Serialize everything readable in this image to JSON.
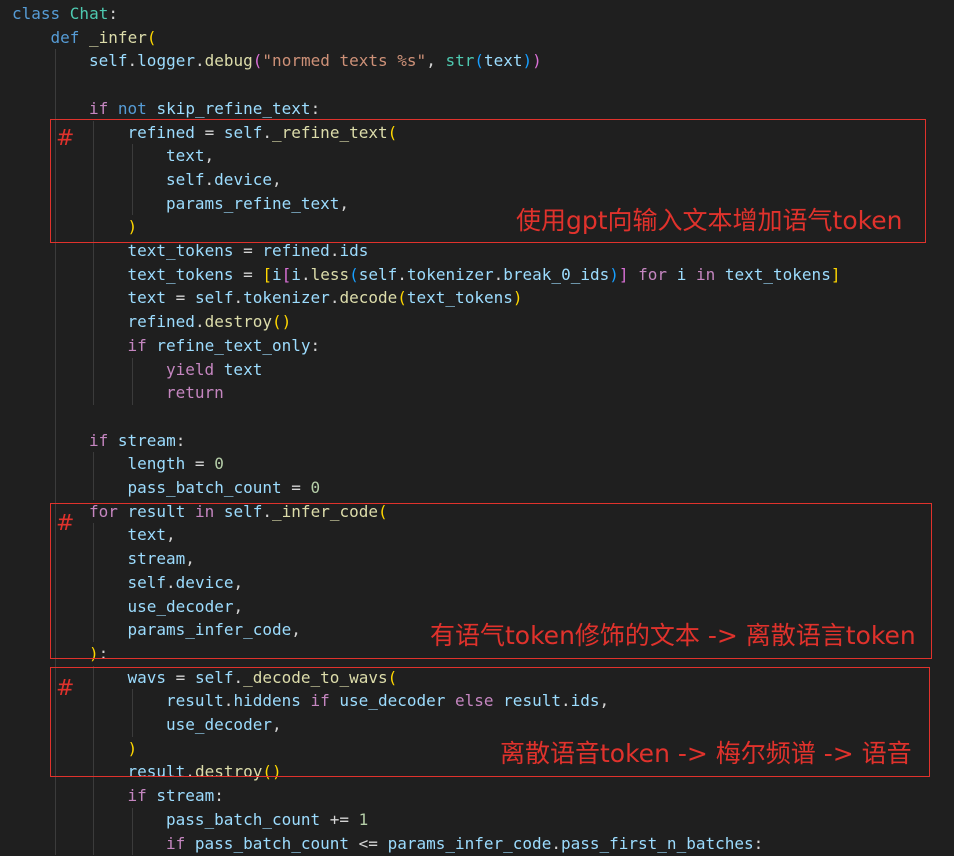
{
  "code": [
    {
      "indent": 0,
      "tokens": [
        [
          "k",
          "class "
        ],
        [
          "cls",
          "Chat"
        ],
        [
          "p",
          ":"
        ]
      ]
    },
    {
      "indent": 1,
      "tokens": [
        [
          "k",
          "def "
        ],
        [
          "f",
          "_infer"
        ],
        [
          "b1",
          "("
        ]
      ]
    },
    {
      "indent": 2,
      "tokens": [
        [
          "v",
          "self"
        ],
        [
          "p",
          "."
        ],
        [
          "v",
          "logger"
        ],
        [
          "p",
          "."
        ],
        [
          "f",
          "debug"
        ],
        [
          "b2",
          "("
        ],
        [
          "s",
          "\"normed texts %s\""
        ],
        [
          "p",
          ", "
        ],
        [
          "cls",
          "str"
        ],
        [
          "b3",
          "("
        ],
        [
          "v",
          "text"
        ],
        [
          "b3",
          ")"
        ],
        [
          "b2",
          ")"
        ]
      ]
    },
    {
      "indent": 2,
      "tokens": []
    },
    {
      "indent": 2,
      "tokens": [
        [
          "c",
          "if "
        ],
        [
          "k",
          "not "
        ],
        [
          "v",
          "skip_refine_text"
        ],
        [
          "p",
          ":"
        ]
      ]
    },
    {
      "indent": 3,
      "tokens": [
        [
          "v",
          "refined"
        ],
        [
          "p",
          " = "
        ],
        [
          "v",
          "self"
        ],
        [
          "p",
          "."
        ],
        [
          "f",
          "_refine_text"
        ],
        [
          "b1",
          "("
        ]
      ]
    },
    {
      "indent": 4,
      "tokens": [
        [
          "v",
          "text"
        ],
        [
          "p",
          ","
        ]
      ]
    },
    {
      "indent": 4,
      "tokens": [
        [
          "v",
          "self"
        ],
        [
          "p",
          "."
        ],
        [
          "v",
          "device"
        ],
        [
          "p",
          ","
        ]
      ]
    },
    {
      "indent": 4,
      "tokens": [
        [
          "v",
          "params_refine_text"
        ],
        [
          "p",
          ","
        ]
      ]
    },
    {
      "indent": 3,
      "tokens": [
        [
          "b1",
          ")"
        ]
      ]
    },
    {
      "indent": 3,
      "tokens": [
        [
          "v",
          "text_tokens"
        ],
        [
          "p",
          " = "
        ],
        [
          "v",
          "refined"
        ],
        [
          "p",
          "."
        ],
        [
          "v",
          "ids"
        ]
      ]
    },
    {
      "indent": 3,
      "tokens": [
        [
          "v",
          "text_tokens"
        ],
        [
          "p",
          " = "
        ],
        [
          "b1",
          "["
        ],
        [
          "v",
          "i"
        ],
        [
          "b2",
          "["
        ],
        [
          "v",
          "i"
        ],
        [
          "p",
          "."
        ],
        [
          "f",
          "less"
        ],
        [
          "b3",
          "("
        ],
        [
          "v",
          "self"
        ],
        [
          "p",
          "."
        ],
        [
          "v",
          "tokenizer"
        ],
        [
          "p",
          "."
        ],
        [
          "v",
          "break_0_ids"
        ],
        [
          "b3",
          ")"
        ],
        [
          "b2",
          "]"
        ],
        [
          "c",
          " for "
        ],
        [
          "v",
          "i"
        ],
        [
          "c",
          " in "
        ],
        [
          "v",
          "text_tokens"
        ],
        [
          "b1",
          "]"
        ]
      ]
    },
    {
      "indent": 3,
      "tokens": [
        [
          "v",
          "text"
        ],
        [
          "p",
          " = "
        ],
        [
          "v",
          "self"
        ],
        [
          "p",
          "."
        ],
        [
          "v",
          "tokenizer"
        ],
        [
          "p",
          "."
        ],
        [
          "f",
          "decode"
        ],
        [
          "b1",
          "("
        ],
        [
          "v",
          "text_tokens"
        ],
        [
          "b1",
          ")"
        ]
      ]
    },
    {
      "indent": 3,
      "tokens": [
        [
          "v",
          "refined"
        ],
        [
          "p",
          "."
        ],
        [
          "f",
          "destroy"
        ],
        [
          "b1",
          "()"
        ]
      ]
    },
    {
      "indent": 3,
      "tokens": [
        [
          "c",
          "if "
        ],
        [
          "v",
          "refine_text_only"
        ],
        [
          "p",
          ":"
        ]
      ]
    },
    {
      "indent": 4,
      "tokens": [
        [
          "c",
          "yield "
        ],
        [
          "v",
          "text"
        ]
      ]
    },
    {
      "indent": 4,
      "tokens": [
        [
          "c",
          "return"
        ]
      ]
    },
    {
      "indent": 2,
      "tokens": []
    },
    {
      "indent": 2,
      "tokens": [
        [
          "c",
          "if "
        ],
        [
          "v",
          "stream"
        ],
        [
          "p",
          ":"
        ]
      ]
    },
    {
      "indent": 3,
      "tokens": [
        [
          "v",
          "length"
        ],
        [
          "p",
          " = "
        ],
        [
          "n",
          "0"
        ]
      ]
    },
    {
      "indent": 3,
      "tokens": [
        [
          "v",
          "pass_batch_count"
        ],
        [
          "p",
          " = "
        ],
        [
          "n",
          "0"
        ]
      ]
    },
    {
      "indent": 2,
      "tokens": [
        [
          "c",
          "for "
        ],
        [
          "v",
          "result"
        ],
        [
          "c",
          " in "
        ],
        [
          "v",
          "self"
        ],
        [
          "p",
          "."
        ],
        [
          "f",
          "_infer_code"
        ],
        [
          "b1",
          "("
        ]
      ]
    },
    {
      "indent": 3,
      "tokens": [
        [
          "v",
          "text"
        ],
        [
          "p",
          ","
        ]
      ]
    },
    {
      "indent": 3,
      "tokens": [
        [
          "v",
          "stream"
        ],
        [
          "p",
          ","
        ]
      ]
    },
    {
      "indent": 3,
      "tokens": [
        [
          "v",
          "self"
        ],
        [
          "p",
          "."
        ],
        [
          "v",
          "device"
        ],
        [
          "p",
          ","
        ]
      ]
    },
    {
      "indent": 3,
      "tokens": [
        [
          "v",
          "use_decoder"
        ],
        [
          "p",
          ","
        ]
      ]
    },
    {
      "indent": 3,
      "tokens": [
        [
          "v",
          "params_infer_code"
        ],
        [
          "p",
          ","
        ]
      ]
    },
    {
      "indent": 2,
      "tokens": [
        [
          "b1",
          ")"
        ],
        [
          "p",
          ":"
        ]
      ]
    },
    {
      "indent": 3,
      "tokens": [
        [
          "v",
          "wavs"
        ],
        [
          "p",
          " = "
        ],
        [
          "v",
          "self"
        ],
        [
          "p",
          "."
        ],
        [
          "f",
          "_decode_to_wavs"
        ],
        [
          "b1",
          "("
        ]
      ]
    },
    {
      "indent": 4,
      "tokens": [
        [
          "v",
          "result"
        ],
        [
          "p",
          "."
        ],
        [
          "v",
          "hiddens"
        ],
        [
          "c",
          " if "
        ],
        [
          "v",
          "use_decoder"
        ],
        [
          "c",
          " else "
        ],
        [
          "v",
          "result"
        ],
        [
          "p",
          "."
        ],
        [
          "v",
          "ids"
        ],
        [
          "p",
          ","
        ]
      ]
    },
    {
      "indent": 4,
      "tokens": [
        [
          "v",
          "use_decoder"
        ],
        [
          "p",
          ","
        ]
      ]
    },
    {
      "indent": 3,
      "tokens": [
        [
          "b1",
          ")"
        ]
      ]
    },
    {
      "indent": 3,
      "tokens": [
        [
          "v",
          "result"
        ],
        [
          "p",
          "."
        ],
        [
          "f",
          "destroy"
        ],
        [
          "b1",
          "()"
        ]
      ]
    },
    {
      "indent": 3,
      "tokens": [
        [
          "c",
          "if "
        ],
        [
          "v",
          "stream"
        ],
        [
          "p",
          ":"
        ]
      ]
    },
    {
      "indent": 4,
      "tokens": [
        [
          "v",
          "pass_batch_count"
        ],
        [
          "p",
          " += "
        ],
        [
          "n",
          "1"
        ]
      ]
    },
    {
      "indent": 4,
      "tokens": [
        [
          "c",
          "if "
        ],
        [
          "v",
          "pass_batch_count"
        ],
        [
          "p",
          " <= "
        ],
        [
          "v",
          "params_infer_code"
        ],
        [
          "p",
          "."
        ],
        [
          "v",
          "pass_first_n_batches"
        ],
        [
          "p",
          ":"
        ]
      ]
    }
  ],
  "annotations": [
    {
      "marker": "#",
      "text": "使用gpt向输入文本增加语气token"
    },
    {
      "marker": "#",
      "text": "有语气token修饰的文本 -> 离散语言token"
    },
    {
      "marker": "#",
      "text": "离散语音token -> 梅尔频谱 -> 语音"
    }
  ],
  "colors": {
    "background": "#1f1f1f",
    "keyword": "#569cd6",
    "control": "#c586c0",
    "class": "#4ec9b0",
    "function": "#dcdcaa",
    "variable": "#9cdcfe",
    "string": "#ce9178",
    "number": "#b5cea8",
    "annotation": "#e0322c"
  }
}
